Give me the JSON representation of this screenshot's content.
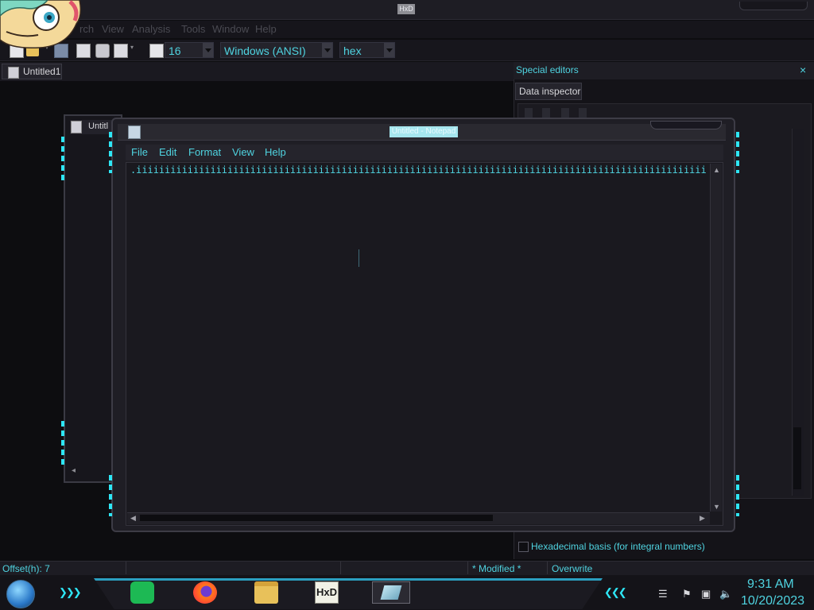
{
  "hxd": {
    "title": "HxD",
    "menu": [
      "rch",
      "View",
      "Analysis",
      "Tools",
      "Window",
      "Help"
    ],
    "toolbar": {
      "bytes_per_row": "16",
      "charset": "Windows (ANSI)",
      "offset_base": "hex"
    },
    "tab_label": "Untitled1",
    "doc_window_label": "Untitl"
  },
  "special_editors": {
    "title": "Special editors",
    "close_glyph": "×",
    "tab": "Data inspector",
    "hex_basis_label": "Hexadecimal basis (for integral numbers)"
  },
  "notepad": {
    "title": "Untitled - Notepad",
    "menu": [
      "File",
      "Edit",
      "Format",
      "View",
      "Help"
    ],
    "content": ".iiiiiiiiiiiiiiiiiiiiiiiiiiiiiiiiiiiiiiiiiiiiiiiiiiiiiiiiiiiiiiiiiiiiiiiiiiiiiiiiiiiiiiiiiiiiiiiiiiiiii"
  },
  "statusbar": {
    "offset": "Offset(h): 7",
    "modified": "* Modified *",
    "mode": "Overwrite"
  },
  "taskbar": {
    "time": "9:31 AM",
    "date": "10/20/2023",
    "apps": [
      "spotify-icon",
      "firefox-icon",
      "file-explorer-icon",
      "hxd-icon",
      "notepad-icon"
    ]
  },
  "colors": {
    "accent": "#4fd3e0",
    "neon": "#2ee6f5",
    "window_bg": "#1a191f"
  }
}
